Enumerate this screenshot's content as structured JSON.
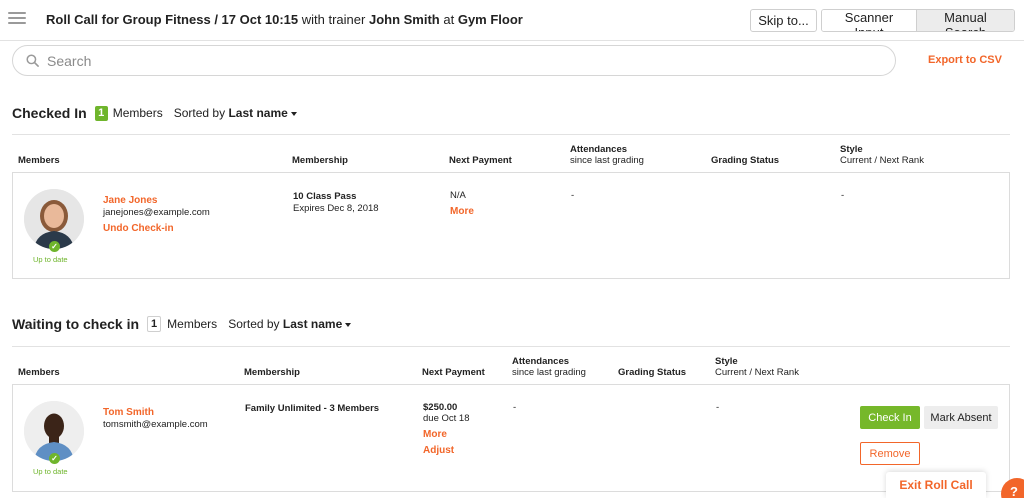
{
  "header": {
    "title_bold": "Roll Call for Group Fitness",
    "title_date": "/ 17 Oct 10:15",
    "title_with": "with trainer",
    "trainer": "John Smith",
    "title_at": "at",
    "location": "Gym Floor",
    "skip_label": "Skip to...",
    "scanner_label": "Scanner Input",
    "manual_label": "Manual Search",
    "menu_icon": "hamburger-icon"
  },
  "search": {
    "placeholder": "Search",
    "value": "",
    "icon": "search-icon"
  },
  "export_label": "Export to CSV",
  "checked_in": {
    "title": "Checked In",
    "count": "1",
    "members_word": "Members",
    "sorted_prefix": "Sorted by",
    "sorted_value": "Last name",
    "columns": {
      "members": "Members",
      "membership": "Membership",
      "next_payment": "Next Payment",
      "attendances": "Attendances",
      "attendances_sub": "since last grading",
      "grading_status": "Grading Status",
      "style": "Style",
      "style_sub": "Current / Next Rank"
    },
    "rows": [
      {
        "name": "Jane Jones",
        "email": "janejones@example.com",
        "action": "Undo Check-in",
        "status": "Up to date",
        "membership": "10 Class Pass",
        "expires": "Expires Dec 8, 2018",
        "payment": "N/A",
        "more": "More",
        "attendances": "-",
        "style": "-"
      }
    ]
  },
  "waiting": {
    "title": "Waiting to check in",
    "count": "1",
    "members_word": "Members",
    "sorted_prefix": "Sorted by",
    "sorted_value": "Last name",
    "columns": {
      "members": "Members",
      "membership": "Membership",
      "next_payment": "Next Payment",
      "attendances": "Attendances",
      "attendances_sub": "since last grading",
      "grading_status": "Grading Status",
      "style": "Style",
      "style_sub": "Current / Next Rank"
    },
    "rows": [
      {
        "name": "Tom Smith",
        "email": "tomsmith@example.com",
        "status": "Up to date",
        "membership": "Family Unlimited - 3 Members",
        "amount": "$250.00",
        "due": "due Oct 18",
        "more": "More",
        "adjust": "Adjust",
        "attendances": "-",
        "style": "-",
        "checkin_label": "Check In",
        "absent_label": "Mark Absent",
        "remove_label": "Remove"
      }
    ]
  },
  "exit_label": "Exit Roll Call",
  "help_label": "?",
  "colors": {
    "accent": "#f2662a",
    "green": "#6fb52c"
  }
}
